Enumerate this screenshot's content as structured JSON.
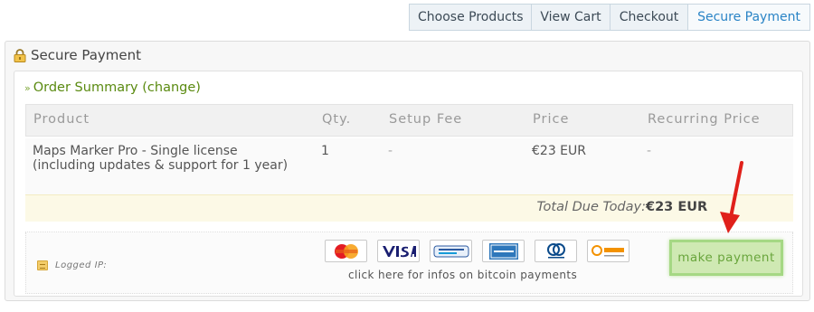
{
  "steps": [
    "Choose Products",
    "View Cart",
    "Checkout",
    "Secure Payment"
  ],
  "panel": {
    "title": "Secure Payment"
  },
  "summary": {
    "prefix": "»",
    "title": "Order Summary",
    "change_open": " (",
    "change": "change",
    "change_close": ")"
  },
  "table": {
    "headers": [
      "Product",
      "Qty.",
      "Setup Fee",
      "Price",
      "Recurring Price"
    ],
    "row": {
      "product": "Maps Marker Pro - Single license (including updates & support for 1 year)",
      "qty": "1",
      "setup_fee": "-",
      "price": "€23 EUR",
      "recurring": "-"
    },
    "total_label": "Total Due Today:",
    "total_value": "€23 EUR"
  },
  "payment": {
    "logged_ip_label": "Logged IP:",
    "cards": [
      "MasterCard",
      "VISA",
      "PayPal",
      "American Express",
      "Diners Club International",
      "sofort"
    ],
    "bitcoin_link": "click here for infos on bitcoin payments",
    "make_payment": "make payment"
  },
  "colors": {
    "accent_blue": "#2a84c6",
    "green": "#5a8a10",
    "highlight_green": "#cfe9b3",
    "arrow_red": "#e0201a"
  }
}
